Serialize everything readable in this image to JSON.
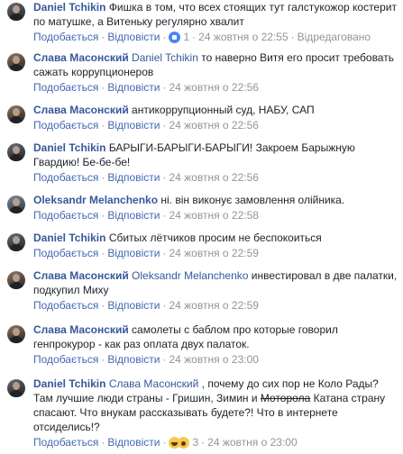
{
  "labels": {
    "like": "Подобається",
    "reply": "Відповісти",
    "edited": "Відредаговано",
    "dot": "·"
  },
  "comments": [
    {
      "author": "Daniel Tchikin",
      "parts": [
        {
          "text": "Фишка в том, что всех стоящих тут галстукожор костерит по матушке, а Витеньку регулярно хвалит",
          "style": "plain"
        }
      ],
      "reaction_count": "1",
      "time": "24 жовтня о 22:55",
      "edited": true
    },
    {
      "author": "Слава Масонский",
      "parts": [
        {
          "text": "Daniel Tchikin",
          "style": "mention"
        },
        {
          "text": " то наверно Витя его просит требовать сажать коррупционеров",
          "style": "plain"
        }
      ],
      "reaction_count": "",
      "time": "24 жовтня о 22:56",
      "edited": false
    },
    {
      "author": "Слава Масонский",
      "parts": [
        {
          "text": "антикоррупционный суд, НАБУ, САП",
          "style": "plain"
        }
      ],
      "reaction_count": "",
      "time": "24 жовтня о 22:56",
      "edited": false
    },
    {
      "author": "Daniel Tchikin",
      "parts": [
        {
          "text": "БАРЫГИ-БАРЫГИ-БАРЫГИ! Закроем Барыжную Гвардию! Бе-бе-бе!",
          "style": "plain"
        }
      ],
      "reaction_count": "",
      "time": "24 жовтня о 22:56",
      "edited": false
    },
    {
      "author": "Oleksandr Melanchenko",
      "parts": [
        {
          "text": "ні. він виконує замовлення олійника.",
          "style": "plain"
        }
      ],
      "reaction_count": "",
      "time": "24 жовтня о 22:58",
      "edited": false
    },
    {
      "author": "Daniel Tchikin",
      "parts": [
        {
          "text": "Сбитых лётчиков просим не беспокоиться",
          "style": "plain"
        }
      ],
      "reaction_count": "",
      "time": "24 жовтня о 22:59",
      "edited": false
    },
    {
      "author": "Слава Масонский",
      "parts": [
        {
          "text": "Oleksandr Melanchenko",
          "style": "mention"
        },
        {
          "text": " инвестировал в две палатки, подкупил Миху",
          "style": "plain"
        }
      ],
      "reaction_count": "",
      "time": "24 жовтня о 22:59",
      "edited": false
    },
    {
      "author": "Слава Масонский",
      "parts": [
        {
          "text": "самолеты с баблом про которые говорил генпрокурор - как раз оплата двух палаток.",
          "style": "plain"
        }
      ],
      "reaction_count": "",
      "time": "24 жовтня о 23:00",
      "edited": false
    },
    {
      "author": "Daniel Tchikin",
      "parts": [
        {
          "text": "Слава Масонский",
          "style": "mention"
        },
        {
          "text": " , почему до сих пор не Коло Рады? Там лучшие люди страны - Гришин, Зимин и ",
          "style": "plain"
        },
        {
          "text": "Моторола",
          "style": "strike"
        },
        {
          "text": " Катана страну спасают. Что внукам рассказывать будете?! Что в интернете отсиделись!?",
          "style": "plain"
        }
      ],
      "reaction_count": "3",
      "time": "24 жовтня о 23:00",
      "edited": false
    }
  ],
  "icons": {
    "like_reaction": "like-reaction-icon",
    "haha_reaction": "haha-reaction-icon",
    "wow_reaction": "wow-reaction-icon"
  },
  "colors": {
    "author": "#365899",
    "action_link": "#4267b2",
    "meta": "#90949c",
    "like": "#4e84f5",
    "haha": "#f7c84b"
  }
}
